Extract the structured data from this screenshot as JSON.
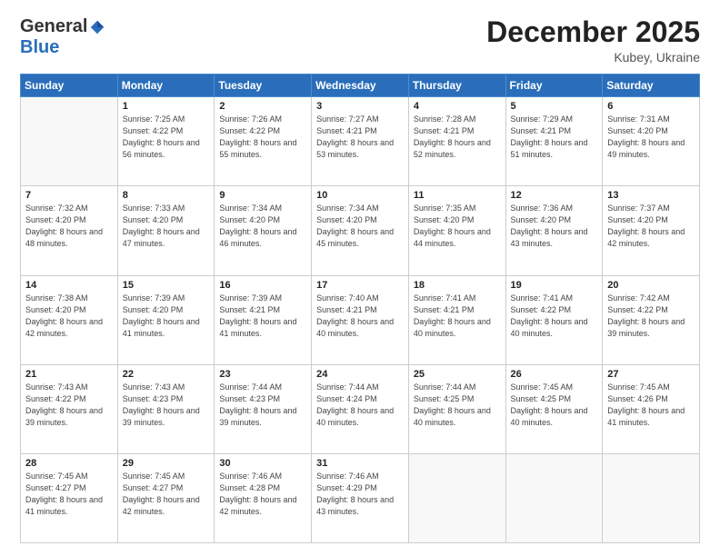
{
  "header": {
    "logo_general": "General",
    "logo_blue": "Blue",
    "month_title": "December 2025",
    "location": "Kubey, Ukraine"
  },
  "days_of_week": [
    "Sunday",
    "Monday",
    "Tuesday",
    "Wednesday",
    "Thursday",
    "Friday",
    "Saturday"
  ],
  "weeks": [
    [
      {
        "day": "",
        "sunrise": "",
        "sunset": "",
        "daylight": "",
        "empty": true
      },
      {
        "day": "1",
        "sunrise": "7:25 AM",
        "sunset": "4:22 PM",
        "daylight": "8 hours and 56 minutes."
      },
      {
        "day": "2",
        "sunrise": "7:26 AM",
        "sunset": "4:22 PM",
        "daylight": "8 hours and 55 minutes."
      },
      {
        "day": "3",
        "sunrise": "7:27 AM",
        "sunset": "4:21 PM",
        "daylight": "8 hours and 53 minutes."
      },
      {
        "day": "4",
        "sunrise": "7:28 AM",
        "sunset": "4:21 PM",
        "daylight": "8 hours and 52 minutes."
      },
      {
        "day": "5",
        "sunrise": "7:29 AM",
        "sunset": "4:21 PM",
        "daylight": "8 hours and 51 minutes."
      },
      {
        "day": "6",
        "sunrise": "7:31 AM",
        "sunset": "4:20 PM",
        "daylight": "8 hours and 49 minutes."
      }
    ],
    [
      {
        "day": "7",
        "sunrise": "7:32 AM",
        "sunset": "4:20 PM",
        "daylight": "8 hours and 48 minutes."
      },
      {
        "day": "8",
        "sunrise": "7:33 AM",
        "sunset": "4:20 PM",
        "daylight": "8 hours and 47 minutes."
      },
      {
        "day": "9",
        "sunrise": "7:34 AM",
        "sunset": "4:20 PM",
        "daylight": "8 hours and 46 minutes."
      },
      {
        "day": "10",
        "sunrise": "7:34 AM",
        "sunset": "4:20 PM",
        "daylight": "8 hours and 45 minutes."
      },
      {
        "day": "11",
        "sunrise": "7:35 AM",
        "sunset": "4:20 PM",
        "daylight": "8 hours and 44 minutes."
      },
      {
        "day": "12",
        "sunrise": "7:36 AM",
        "sunset": "4:20 PM",
        "daylight": "8 hours and 43 minutes."
      },
      {
        "day": "13",
        "sunrise": "7:37 AM",
        "sunset": "4:20 PM",
        "daylight": "8 hours and 42 minutes."
      }
    ],
    [
      {
        "day": "14",
        "sunrise": "7:38 AM",
        "sunset": "4:20 PM",
        "daylight": "8 hours and 42 minutes."
      },
      {
        "day": "15",
        "sunrise": "7:39 AM",
        "sunset": "4:20 PM",
        "daylight": "8 hours and 41 minutes."
      },
      {
        "day": "16",
        "sunrise": "7:39 AM",
        "sunset": "4:21 PM",
        "daylight": "8 hours and 41 minutes."
      },
      {
        "day": "17",
        "sunrise": "7:40 AM",
        "sunset": "4:21 PM",
        "daylight": "8 hours and 40 minutes."
      },
      {
        "day": "18",
        "sunrise": "7:41 AM",
        "sunset": "4:21 PM",
        "daylight": "8 hours and 40 minutes."
      },
      {
        "day": "19",
        "sunrise": "7:41 AM",
        "sunset": "4:22 PM",
        "daylight": "8 hours and 40 minutes."
      },
      {
        "day": "20",
        "sunrise": "7:42 AM",
        "sunset": "4:22 PM",
        "daylight": "8 hours and 39 minutes."
      }
    ],
    [
      {
        "day": "21",
        "sunrise": "7:43 AM",
        "sunset": "4:22 PM",
        "daylight": "8 hours and 39 minutes."
      },
      {
        "day": "22",
        "sunrise": "7:43 AM",
        "sunset": "4:23 PM",
        "daylight": "8 hours and 39 minutes."
      },
      {
        "day": "23",
        "sunrise": "7:44 AM",
        "sunset": "4:23 PM",
        "daylight": "8 hours and 39 minutes."
      },
      {
        "day": "24",
        "sunrise": "7:44 AM",
        "sunset": "4:24 PM",
        "daylight": "8 hours and 40 minutes."
      },
      {
        "day": "25",
        "sunrise": "7:44 AM",
        "sunset": "4:25 PM",
        "daylight": "8 hours and 40 minutes."
      },
      {
        "day": "26",
        "sunrise": "7:45 AM",
        "sunset": "4:25 PM",
        "daylight": "8 hours and 40 minutes."
      },
      {
        "day": "27",
        "sunrise": "7:45 AM",
        "sunset": "4:26 PM",
        "daylight": "8 hours and 41 minutes."
      }
    ],
    [
      {
        "day": "28",
        "sunrise": "7:45 AM",
        "sunset": "4:27 PM",
        "daylight": "8 hours and 41 minutes."
      },
      {
        "day": "29",
        "sunrise": "7:45 AM",
        "sunset": "4:27 PM",
        "daylight": "8 hours and 42 minutes."
      },
      {
        "day": "30",
        "sunrise": "7:46 AM",
        "sunset": "4:28 PM",
        "daylight": "8 hours and 42 minutes."
      },
      {
        "day": "31",
        "sunrise": "7:46 AM",
        "sunset": "4:29 PM",
        "daylight": "8 hours and 43 minutes."
      },
      {
        "day": "",
        "sunrise": "",
        "sunset": "",
        "daylight": "",
        "empty": true
      },
      {
        "day": "",
        "sunrise": "",
        "sunset": "",
        "daylight": "",
        "empty": true
      },
      {
        "day": "",
        "sunrise": "",
        "sunset": "",
        "daylight": "",
        "empty": true
      }
    ]
  ],
  "row_shading": [
    "white",
    "shade",
    "white",
    "shade",
    "white"
  ],
  "labels": {
    "sunrise_prefix": "Sunrise: ",
    "sunset_prefix": "Sunset: ",
    "daylight_prefix": "Daylight: "
  }
}
